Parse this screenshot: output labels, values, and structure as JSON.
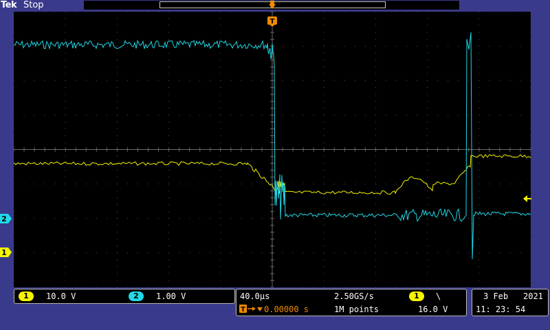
{
  "header": {
    "brand": "Tek",
    "run_state": "Stop"
  },
  "trigger_marker": "T",
  "channel_markers": {
    "ch1": "1",
    "ch2": "2"
  },
  "colors": {
    "ch1": "#f5f500",
    "ch2": "#20d8e8",
    "trigger": "#f08a00",
    "background": "#000000",
    "frame": "#3a3a8c"
  },
  "vertical": {
    "ch1": {
      "badge": "1",
      "scale": "10.0 V"
    },
    "ch2": {
      "badge": "2",
      "scale": "1.00 V"
    }
  },
  "horizontal": {
    "time_per_div": "40.0µs",
    "sample_rate": "2.50GS/s",
    "trigger_position": "0.00000 s",
    "record_length": "1M points"
  },
  "trigger": {
    "source_badge": "1",
    "slope": "\\",
    "level": "16.0 V"
  },
  "datetime": {
    "date_day_month": "3 Feb",
    "year": "2021",
    "time": "11: 23: 54"
  }
}
